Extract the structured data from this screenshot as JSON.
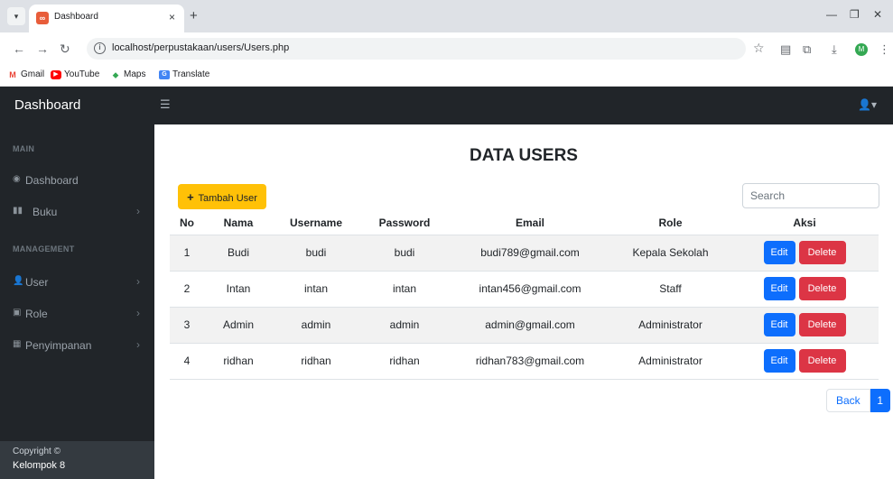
{
  "browser": {
    "tab_title": "Dashboard",
    "tab_close": "×",
    "new_tab": "+",
    "url": "localhost/perpustakaan/users/Users.php",
    "bookmarks": [
      {
        "label": "Gmail",
        "icon": "gmail-icon",
        "color": "#ea4335"
      },
      {
        "label": "YouTube",
        "icon": "youtube-icon",
        "color": "#ff0000"
      },
      {
        "label": "Maps",
        "icon": "maps-icon",
        "color": "#34a853"
      },
      {
        "label": "Translate",
        "icon": "translate-icon",
        "color": "#4285f4"
      }
    ],
    "profile_initial": "M"
  },
  "topnav": {
    "brand": "Dashboard"
  },
  "sidebar": {
    "heading_main": "MAIN",
    "heading_management": "MANAGEMENT",
    "items": [
      {
        "label": "Dashboard",
        "icon": "dashboard-icon"
      },
      {
        "label": "Buku",
        "icon": "book-icon"
      },
      {
        "label": "User",
        "icon": "user-icon"
      },
      {
        "label": "Role",
        "icon": "role-icon"
      },
      {
        "label": "Penyimpanan",
        "icon": "storage-icon"
      }
    ],
    "footer_line1": "Copyright ©",
    "footer_line2": "Kelompok 8"
  },
  "main": {
    "title": "DATA USERS",
    "add_button": "Tambah User",
    "search_placeholder": "Search",
    "columns": [
      "No",
      "Nama",
      "Username",
      "Password",
      "Email",
      "Role",
      "Aksi"
    ],
    "rows": [
      {
        "no": "1",
        "nama": "Budi",
        "username": "budi",
        "password": "budi",
        "email": "budi789@gmail.com",
        "role": "Kepala Sekolah"
      },
      {
        "no": "2",
        "nama": "Intan",
        "username": "intan",
        "password": "intan",
        "email": "intan456@gmail.com",
        "role": "Staff"
      },
      {
        "no": "3",
        "nama": "Admin",
        "username": "admin",
        "password": "admin",
        "email": "admin@gmail.com",
        "role": "Administrator"
      },
      {
        "no": "4",
        "nama": "ridhan",
        "username": "ridhan",
        "password": "ridhan",
        "email": "ridhan783@gmail.com",
        "role": "Administrator"
      }
    ],
    "edit_label": "Edit",
    "delete_label": "Delete",
    "pager_back": "Back",
    "pager_page": "1"
  },
  "colors": {
    "dark": "#212529",
    "add": "#ffc107",
    "edit": "#0d6efd",
    "delete": "#dc3545"
  }
}
